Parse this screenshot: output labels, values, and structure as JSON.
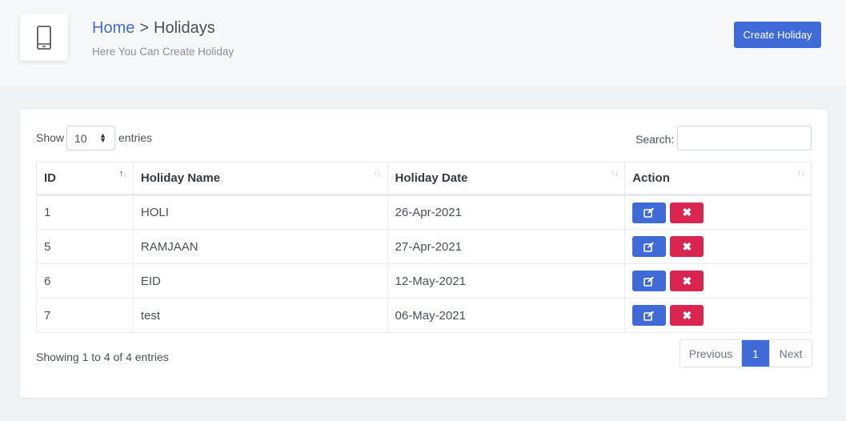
{
  "header": {
    "breadcrumb_home": "Home",
    "breadcrumb_separator": ">",
    "breadcrumb_current": "Holidays",
    "subtitle": "Here You Can Create Holiday",
    "create_button": "Create Holiday",
    "icon": "mobile-phone-icon"
  },
  "controls": {
    "show_label": "Show",
    "entries_value": "10",
    "entries_label": "entries",
    "search_label": "Search:",
    "search_value": ""
  },
  "table": {
    "headers": [
      "ID",
      "Holiday Name",
      "Holiday Date",
      "Action"
    ],
    "rows": [
      {
        "id": "1",
        "name": "HOLI",
        "date": "26-Apr-2021"
      },
      {
        "id": "5",
        "name": "RAMJAAN",
        "date": "27-Apr-2021"
      },
      {
        "id": "6",
        "name": "EID",
        "date": "12-May-2021"
      },
      {
        "id": "7",
        "name": "test",
        "date": "06-May-2021"
      }
    ],
    "row_actions": [
      "edit-icon",
      "delete-icon"
    ]
  },
  "footer": {
    "info": "Showing 1 to 4 of 4 entries",
    "prev_label": "Previous",
    "current_page": "1",
    "next_label": "Next"
  },
  "colors": {
    "primary": "#3f6ad8",
    "danger": "#d92550"
  }
}
